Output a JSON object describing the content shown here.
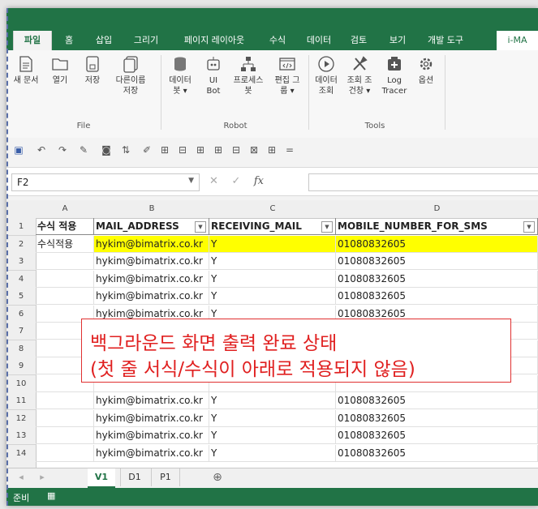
{
  "ribbon_tabs": [
    "파일",
    "홈",
    "삽입",
    "그리기",
    "페이지 레이아웃",
    "수식",
    "데이터",
    "검토",
    "보기",
    "개발 도구",
    "i-MA"
  ],
  "ribbon": {
    "file_group": {
      "label": "File",
      "buttons": [
        {
          "label": "새 문서",
          "icon": "new-document-icon"
        },
        {
          "label": "열기",
          "icon": "open-folder-icon"
        },
        {
          "label": "저장",
          "icon": "save-icon"
        },
        {
          "label": "다른이름\n저장",
          "icon": "save-as-icon"
        }
      ]
    },
    "robot_group": {
      "label": "Robot",
      "buttons": [
        {
          "label": "데이터\n봇 ▾",
          "icon": "database-icon"
        },
        {
          "label": "UI\nBot",
          "icon": "robot-icon"
        },
        {
          "label": "프로세스\n봇",
          "icon": "process-tree-icon"
        },
        {
          "label": "편집 그\n룹 ▾",
          "icon": "code-edit-icon"
        }
      ]
    },
    "tools_group": {
      "label": "Tools",
      "buttons": [
        {
          "label": "데이터\n조회",
          "icon": "play-icon"
        },
        {
          "label": "조회 조\n건창 ▾",
          "icon": "tools-icon"
        },
        {
          "label": "Log\nTracer",
          "icon": "log-tracer-icon"
        },
        {
          "label": "옵션",
          "icon": "gear-icon"
        }
      ]
    }
  },
  "name_box": "F2",
  "fx_label": "fx",
  "columns": [
    "A",
    "B",
    "C",
    "D"
  ],
  "header_row": {
    "row": "1",
    "cells": [
      "수식 적용",
      "MAIL_ADDRESS",
      "RECEIVING_MAIL",
      "MOBILE_NUMBER_FOR_SMS"
    ]
  },
  "rows": [
    {
      "row": "2",
      "a": "수식적용",
      "b": "hykim@bimatrix.co.kr",
      "c": "Y",
      "d": "01080832605",
      "highlight": true
    },
    {
      "row": "3",
      "a": "",
      "b": "hykim@bimatrix.co.kr",
      "c": "Y",
      "d": "01080832605"
    },
    {
      "row": "4",
      "a": "",
      "b": "hykim@bimatrix.co.kr",
      "c": "Y",
      "d": "01080832605"
    },
    {
      "row": "5",
      "a": "",
      "b": "hykim@bimatrix.co.kr",
      "c": "Y",
      "d": "01080832605"
    },
    {
      "row": "6",
      "a": "",
      "b": "hykim@bimatrix.co.kr",
      "c": "Y",
      "d": "01080832605"
    },
    {
      "row": "7",
      "a": "",
      "b": "",
      "c": "",
      "d": ""
    },
    {
      "row": "8",
      "a": "",
      "b": "",
      "c": "",
      "d": ""
    },
    {
      "row": "9",
      "a": "",
      "b": "",
      "c": "",
      "d": ""
    },
    {
      "row": "10",
      "a": "",
      "b": "",
      "c": "",
      "d": ""
    },
    {
      "row": "11",
      "a": "",
      "b": "hykim@bimatrix.co.kr",
      "c": "Y",
      "d": "01080832605"
    },
    {
      "row": "12",
      "a": "",
      "b": "hykim@bimatrix.co.kr",
      "c": "Y",
      "d": "01080832605"
    },
    {
      "row": "13",
      "a": "",
      "b": "hykim@bimatrix.co.kr",
      "c": "Y",
      "d": "01080832605"
    },
    {
      "row": "14",
      "a": "",
      "b": "hykim@bimatrix.co.kr",
      "c": "Y",
      "d": "01080832605"
    }
  ],
  "callout": {
    "line1": "백그라운드 화면 출력 완료 상태",
    "line2": "(첫 줄 서식/수식이 아래로 적용되지 않음)"
  },
  "sheet_tabs": [
    "V1",
    "D1",
    "P1"
  ],
  "status": {
    "ready": "준비"
  },
  "colors": {
    "excel_green": "#217346",
    "highlight_yellow": "#ffff00",
    "callout_red": "#e02020"
  }
}
